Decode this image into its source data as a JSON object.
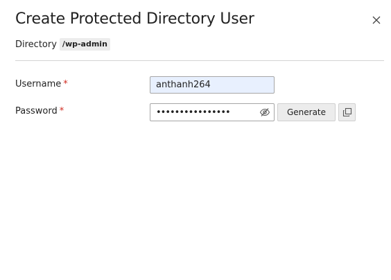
{
  "dialog": {
    "title": "Create Protected Directory User",
    "close_icon": "close-icon"
  },
  "directory": {
    "label": "Directory",
    "value": "/wp-admin"
  },
  "form": {
    "username": {
      "label": "Username",
      "required_mark": "*",
      "value": "anthanh264"
    },
    "password": {
      "label": "Password",
      "required_mark": "*",
      "value": "••••••••••••••••",
      "toggle_icon": "eye-slash-icon"
    },
    "generate_label": "Generate",
    "copy_icon": "copy-icon"
  },
  "colors": {
    "required": "#d02b20",
    "autofill_background": "#e8f0fe",
    "button_background": "#ececec"
  }
}
